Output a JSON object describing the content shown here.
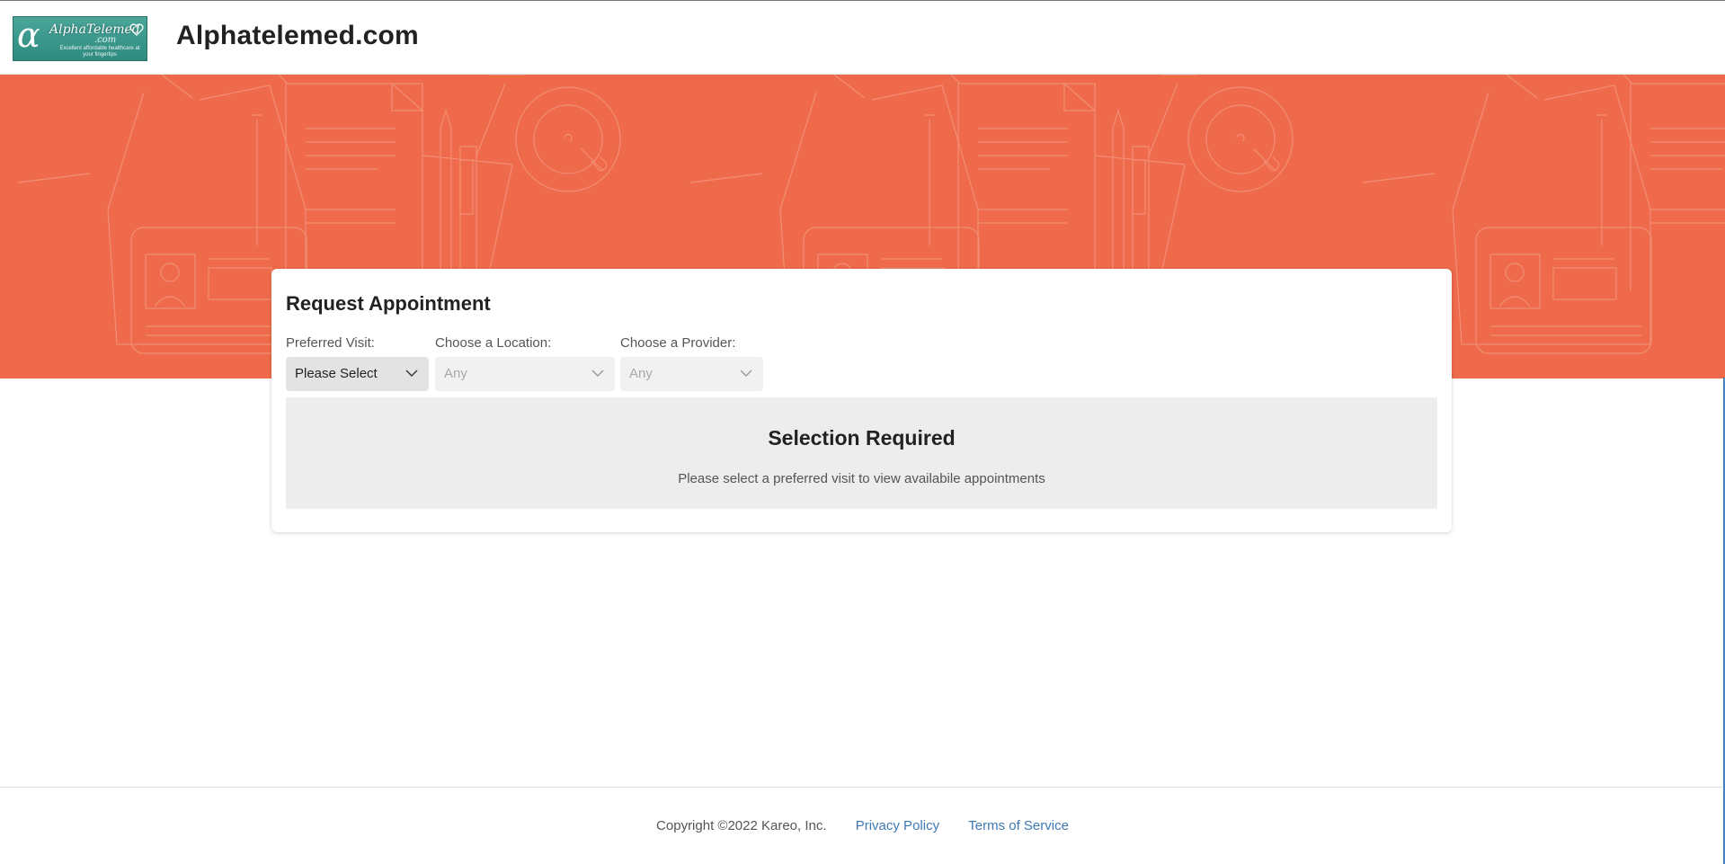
{
  "header": {
    "logo": {
      "symbol": "α",
      "word": "AlphaTelemed",
      "domain": ".com",
      "tagline": "Excellent affordable healthcare at your fingertips"
    },
    "site_title": "Alphatelemed.com"
  },
  "appointment": {
    "title": "Request Appointment",
    "fields": {
      "visit": {
        "label": "Preferred Visit:",
        "value": "Please Select"
      },
      "location": {
        "label": "Choose a Location:",
        "value": "Any"
      },
      "provider": {
        "label": "Choose a Provider:",
        "value": "Any"
      }
    },
    "notice": {
      "title": "Selection Required",
      "message": "Please select a preferred visit to view availabile appointments"
    }
  },
  "footer": {
    "copyright": "Copyright ©2022 Kareo, Inc.",
    "privacy": "Privacy Policy",
    "terms": "Terms of Service"
  },
  "colors": {
    "banner": "#ee6a4a",
    "link": "#3f79b5",
    "logo_teal": "#3a968b"
  }
}
